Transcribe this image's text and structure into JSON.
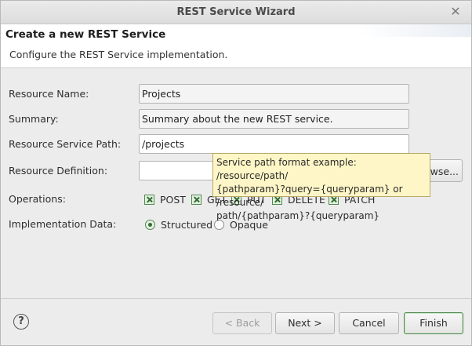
{
  "window": {
    "title": "REST Service Wizard"
  },
  "header": {
    "title": "Create a new REST Service",
    "description": "Configure the REST Service implementation."
  },
  "form": {
    "resource_name": {
      "label": "Resource Name:",
      "value": "Projects"
    },
    "summary": {
      "label": "Summary:",
      "value": "Summary about the new REST service."
    },
    "service_path": {
      "label": "Resource Service Path:",
      "value": "/projects"
    },
    "definition": {
      "label": "Resource Definition:",
      "value": "",
      "browse_label": "Browse..."
    },
    "operations": {
      "label": "Operations:",
      "items": [
        {
          "label": "POST",
          "checked": true
        },
        {
          "label": "GET",
          "checked": true
        },
        {
          "label": "PUT",
          "checked": true
        },
        {
          "label": "DELETE",
          "checked": true
        },
        {
          "label": "PATCH",
          "checked": true
        }
      ]
    },
    "implementation": {
      "label": "Implementation Data:",
      "options": [
        {
          "label": "Structured",
          "selected": true
        },
        {
          "label": "Opaque",
          "selected": false
        }
      ]
    }
  },
  "tooltip": {
    "lines": [
      "Service path format example: /resource/path/",
      "{pathparam}?query={queryparam} or /resource/",
      "path/{pathparam}?{queryparam}"
    ]
  },
  "footer": {
    "help": "?",
    "back_label": "< Back",
    "next_label": "Next >",
    "cancel_label": "Cancel",
    "finish_label": "Finish"
  },
  "colors": {
    "accent": "#4e8a4e",
    "tooltip_bg": "#fef6c6"
  }
}
